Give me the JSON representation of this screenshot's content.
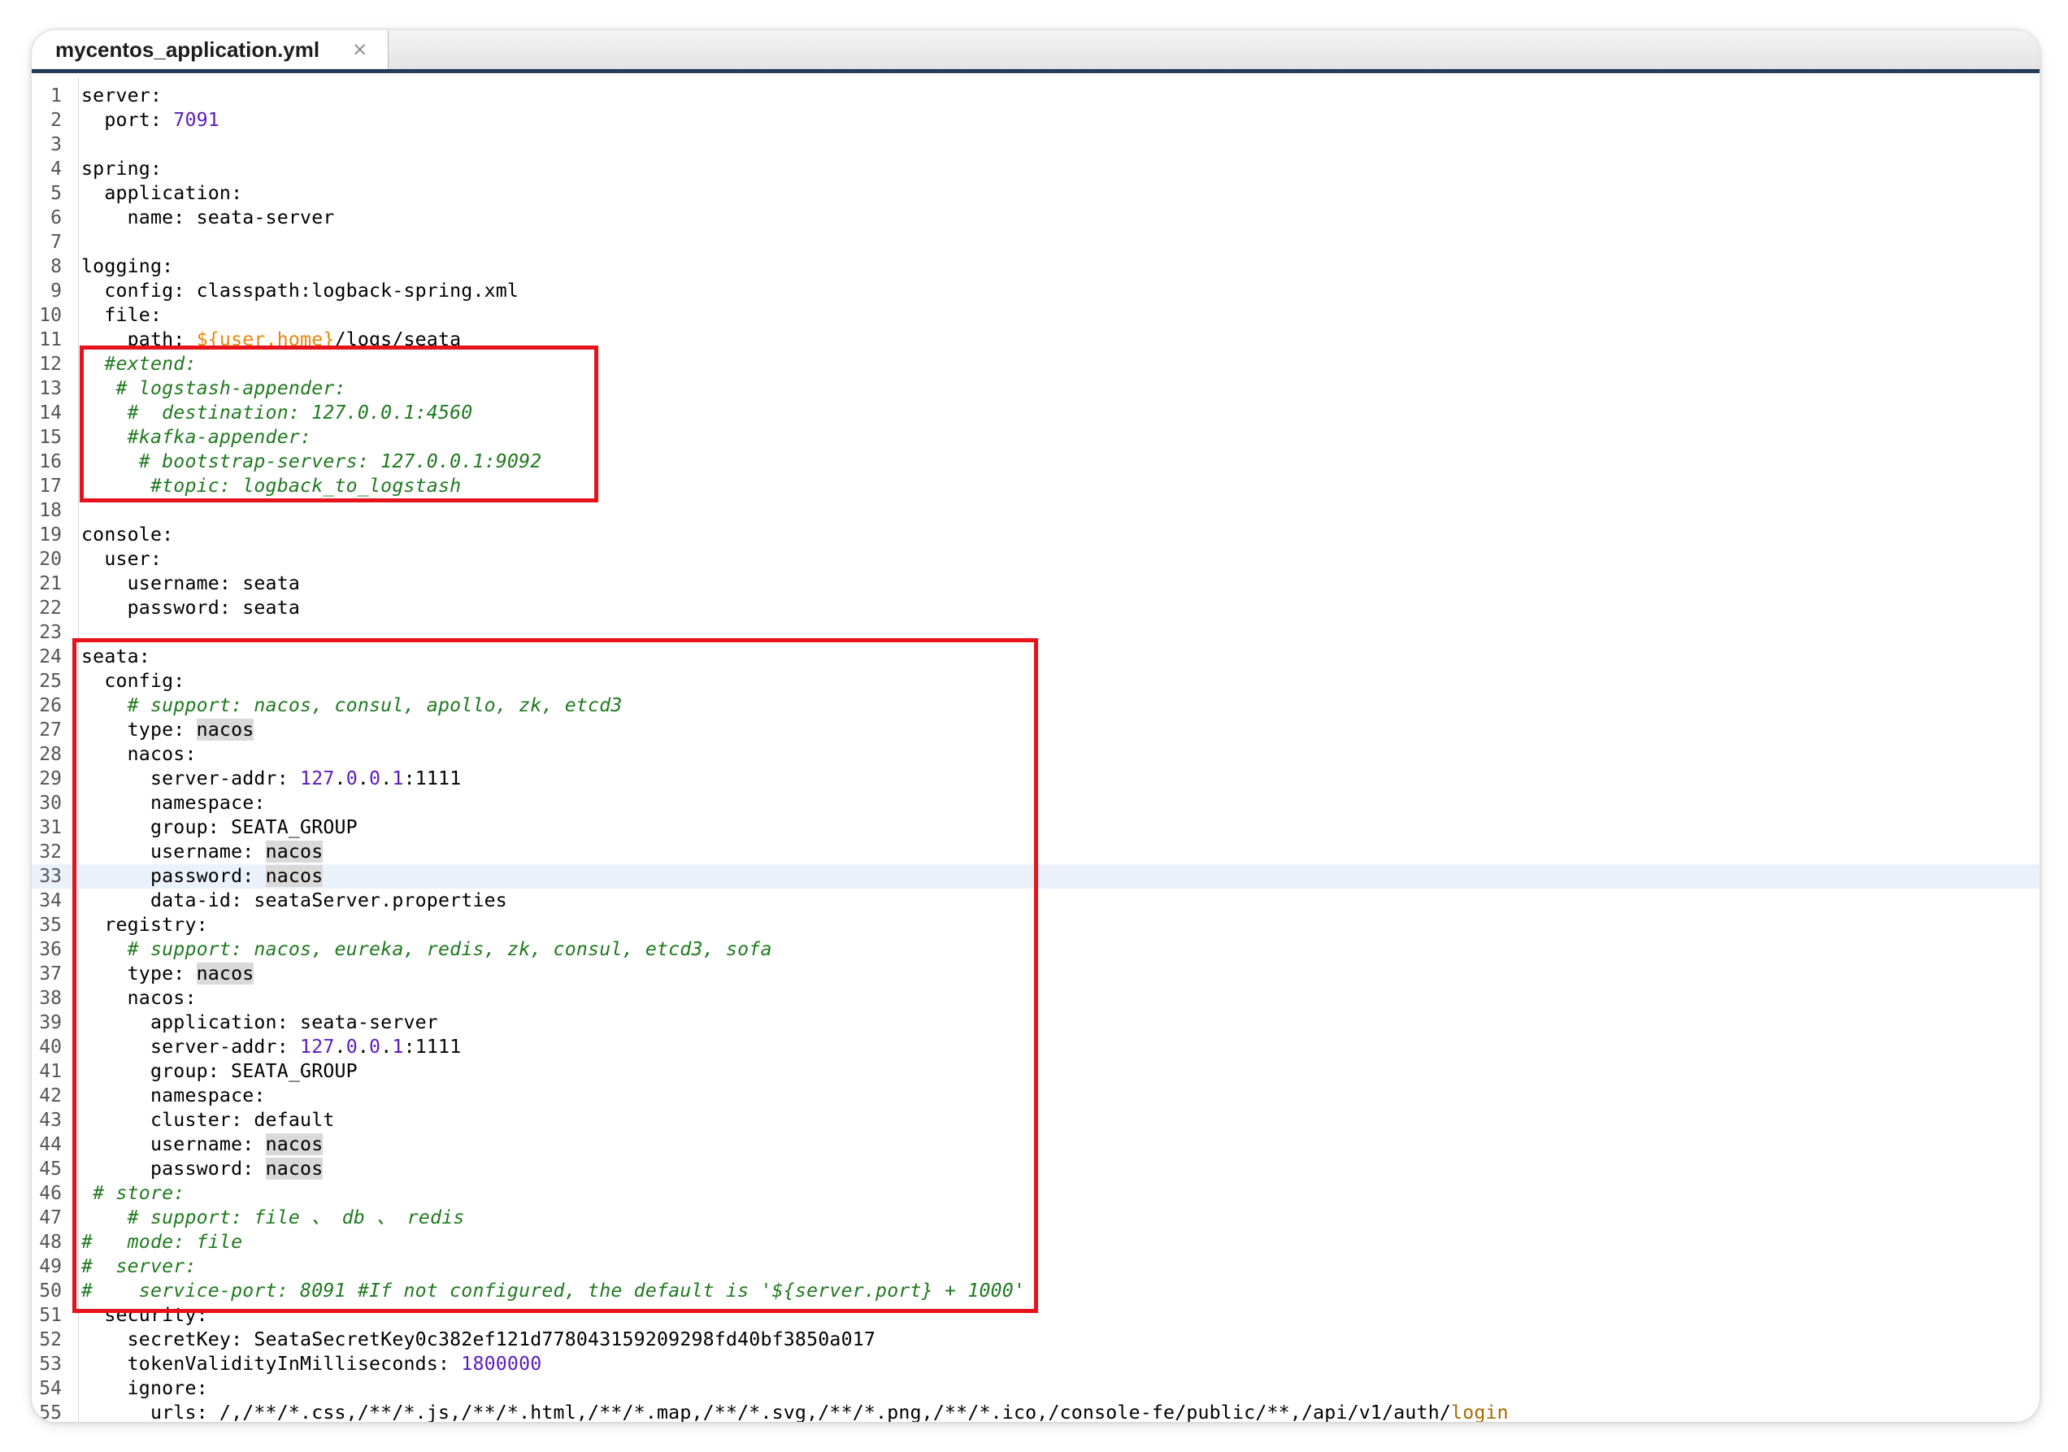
{
  "tab": {
    "title": "mycentos_application.yml",
    "close": "×"
  },
  "editor": {
    "current_line": 33
  },
  "lines": [
    {
      "n": "1",
      "tokens": [
        [
          "server:",
          "plain"
        ]
      ]
    },
    {
      "n": "2",
      "tokens": [
        [
          "  port: ",
          "plain"
        ],
        [
          "7091",
          "num"
        ]
      ]
    },
    {
      "n": "3",
      "tokens": []
    },
    {
      "n": "4",
      "tokens": [
        [
          "spring:",
          "plain"
        ]
      ]
    },
    {
      "n": "5",
      "tokens": [
        [
          "  application:",
          "plain"
        ]
      ]
    },
    {
      "n": "6",
      "tokens": [
        [
          "    name: seata-server",
          "plain"
        ]
      ]
    },
    {
      "n": "7",
      "tokens": []
    },
    {
      "n": "8",
      "tokens": [
        [
          "logging:",
          "plain"
        ]
      ]
    },
    {
      "n": "9",
      "tokens": [
        [
          "  config: classpath:logback-spring.xml",
          "plain"
        ]
      ]
    },
    {
      "n": "10",
      "tokens": [
        [
          "  file:",
          "plain"
        ]
      ]
    },
    {
      "n": "11",
      "tokens": [
        [
          "    path: ",
          "plain"
        ],
        [
          "${user.home}",
          "var"
        ],
        [
          "/logs/seata",
          "plain"
        ]
      ]
    },
    {
      "n": "12",
      "tokens": [
        [
          "  #extend:",
          "cmt"
        ]
      ]
    },
    {
      "n": "13",
      "tokens": [
        [
          "   # logstash-appender:",
          "cmt"
        ]
      ]
    },
    {
      "n": "14",
      "tokens": [
        [
          "    #  destination: 127.0.0.1:4560",
          "cmt"
        ]
      ]
    },
    {
      "n": "15",
      "tokens": [
        [
          "    #kafka-appender:",
          "cmt"
        ]
      ]
    },
    {
      "n": "16",
      "tokens": [
        [
          "     # bootstrap-servers: 127.0.0.1:9092",
          "cmt"
        ]
      ]
    },
    {
      "n": "17",
      "tokens": [
        [
          "      #topic: logback_to_logstash",
          "cmt"
        ]
      ]
    },
    {
      "n": "18",
      "tokens": []
    },
    {
      "n": "19",
      "tokens": [
        [
          "console:",
          "plain"
        ]
      ]
    },
    {
      "n": "20",
      "tokens": [
        [
          "  user:",
          "plain"
        ]
      ]
    },
    {
      "n": "21",
      "tokens": [
        [
          "    username: seata",
          "plain"
        ]
      ]
    },
    {
      "n": "22",
      "tokens": [
        [
          "    password: seata",
          "plain"
        ]
      ]
    },
    {
      "n": "23",
      "tokens": []
    },
    {
      "n": "24",
      "tokens": [
        [
          "seata:",
          "plain"
        ]
      ]
    },
    {
      "n": "25",
      "tokens": [
        [
          "  config:",
          "plain"
        ]
      ]
    },
    {
      "n": "26",
      "tokens": [
        [
          "    # support: nacos, consul, apollo, zk, etcd3",
          "cmt"
        ]
      ]
    },
    {
      "n": "27",
      "tokens": [
        [
          "    type: ",
          "plain"
        ],
        [
          "nacos",
          "hl"
        ]
      ]
    },
    {
      "n": "28",
      "tokens": [
        [
          "    nacos:",
          "plain"
        ]
      ]
    },
    {
      "n": "29",
      "tokens": [
        [
          "      server-addr: ",
          "plain"
        ],
        [
          "127",
          "num"
        ],
        [
          ".",
          "plain"
        ],
        [
          "0",
          "num"
        ],
        [
          ".",
          "plain"
        ],
        [
          "0",
          "num"
        ],
        [
          ".",
          "plain"
        ],
        [
          "1",
          "num"
        ],
        [
          ":1111",
          "plain"
        ]
      ]
    },
    {
      "n": "30",
      "tokens": [
        [
          "      namespace:",
          "plain"
        ]
      ]
    },
    {
      "n": "31",
      "tokens": [
        [
          "      group: SEATA_GROUP",
          "plain"
        ]
      ]
    },
    {
      "n": "32",
      "tokens": [
        [
          "      username: ",
          "plain"
        ],
        [
          "nacos",
          "hl"
        ]
      ]
    },
    {
      "n": "33",
      "tokens": [
        [
          "      password: ",
          "plain"
        ],
        [
          "nacos",
          "hl"
        ]
      ]
    },
    {
      "n": "34",
      "tokens": [
        [
          "      data-id: seataServer.properties",
          "plain"
        ]
      ]
    },
    {
      "n": "35",
      "tokens": [
        [
          "  registry:",
          "plain"
        ]
      ]
    },
    {
      "n": "36",
      "tokens": [
        [
          "    # support: nacos, eureka, redis, zk, consul, etcd3, sofa",
          "cmt"
        ]
      ]
    },
    {
      "n": "37",
      "tokens": [
        [
          "    type: ",
          "plain"
        ],
        [
          "nacos",
          "hl"
        ]
      ]
    },
    {
      "n": "38",
      "tokens": [
        [
          "    nacos:",
          "plain"
        ]
      ]
    },
    {
      "n": "39",
      "tokens": [
        [
          "      application: seata-server",
          "plain"
        ]
      ]
    },
    {
      "n": "40",
      "tokens": [
        [
          "      server-addr: ",
          "plain"
        ],
        [
          "127",
          "num"
        ],
        [
          ".",
          "plain"
        ],
        [
          "0",
          "num"
        ],
        [
          ".",
          "plain"
        ],
        [
          "0",
          "num"
        ],
        [
          ".",
          "plain"
        ],
        [
          "1",
          "num"
        ],
        [
          ":1111",
          "plain"
        ]
      ]
    },
    {
      "n": "41",
      "tokens": [
        [
          "      group: SEATA_GROUP",
          "plain"
        ]
      ]
    },
    {
      "n": "42",
      "tokens": [
        [
          "      namespace:",
          "plain"
        ]
      ]
    },
    {
      "n": "43",
      "tokens": [
        [
          "      cluster: default",
          "plain"
        ]
      ]
    },
    {
      "n": "44",
      "tokens": [
        [
          "      username: ",
          "plain"
        ],
        [
          "nacos",
          "hl"
        ]
      ]
    },
    {
      "n": "45",
      "tokens": [
        [
          "      password: ",
          "plain"
        ],
        [
          "nacos",
          "hl"
        ]
      ]
    },
    {
      "n": "46",
      "tokens": [
        [
          " # store:",
          "cmt"
        ]
      ]
    },
    {
      "n": "47",
      "tokens": [
        [
          "    # support: file 、 db 、 redis",
          "cmt"
        ]
      ]
    },
    {
      "n": "48",
      "tokens": [
        [
          "#   mode: file",
          "cmt"
        ]
      ]
    },
    {
      "n": "49",
      "tokens": [
        [
          "#  server:",
          "cmt"
        ]
      ]
    },
    {
      "n": "50",
      "tokens": [
        [
          "#    service-port: 8091 #If not configured, the default is '${server.port} + 1000'",
          "cmt"
        ]
      ]
    },
    {
      "n": "51",
      "tokens": [
        [
          "  security:",
          "plain"
        ]
      ]
    },
    {
      "n": "52",
      "tokens": [
        [
          "    secretKey: SeataSecretKey0c382ef121d778043159209298fd40bf3850a017",
          "plain"
        ]
      ]
    },
    {
      "n": "53",
      "tokens": [
        [
          "    tokenValidityInMilliseconds: ",
          "plain"
        ],
        [
          "1800000",
          "num"
        ]
      ]
    },
    {
      "n": "54",
      "tokens": [
        [
          "    ignore:",
          "plain"
        ]
      ]
    },
    {
      "n": "55",
      "tokens": [
        [
          "      urls: /,/**/*.css,/**/*.js,/**/*.html,/**/*.map,/**/*.svg,/**/*.png,/**/*.ico,/console-fe/public/**,/api/v1/auth/",
          "plain"
        ],
        [
          "login",
          "kw"
        ]
      ]
    }
  ],
  "annotations": [
    {
      "from_line": 12,
      "to_line": 17,
      "color": "#e8121b"
    },
    {
      "from_line": 24,
      "to_line": 50,
      "color": "#e8121b"
    }
  ]
}
